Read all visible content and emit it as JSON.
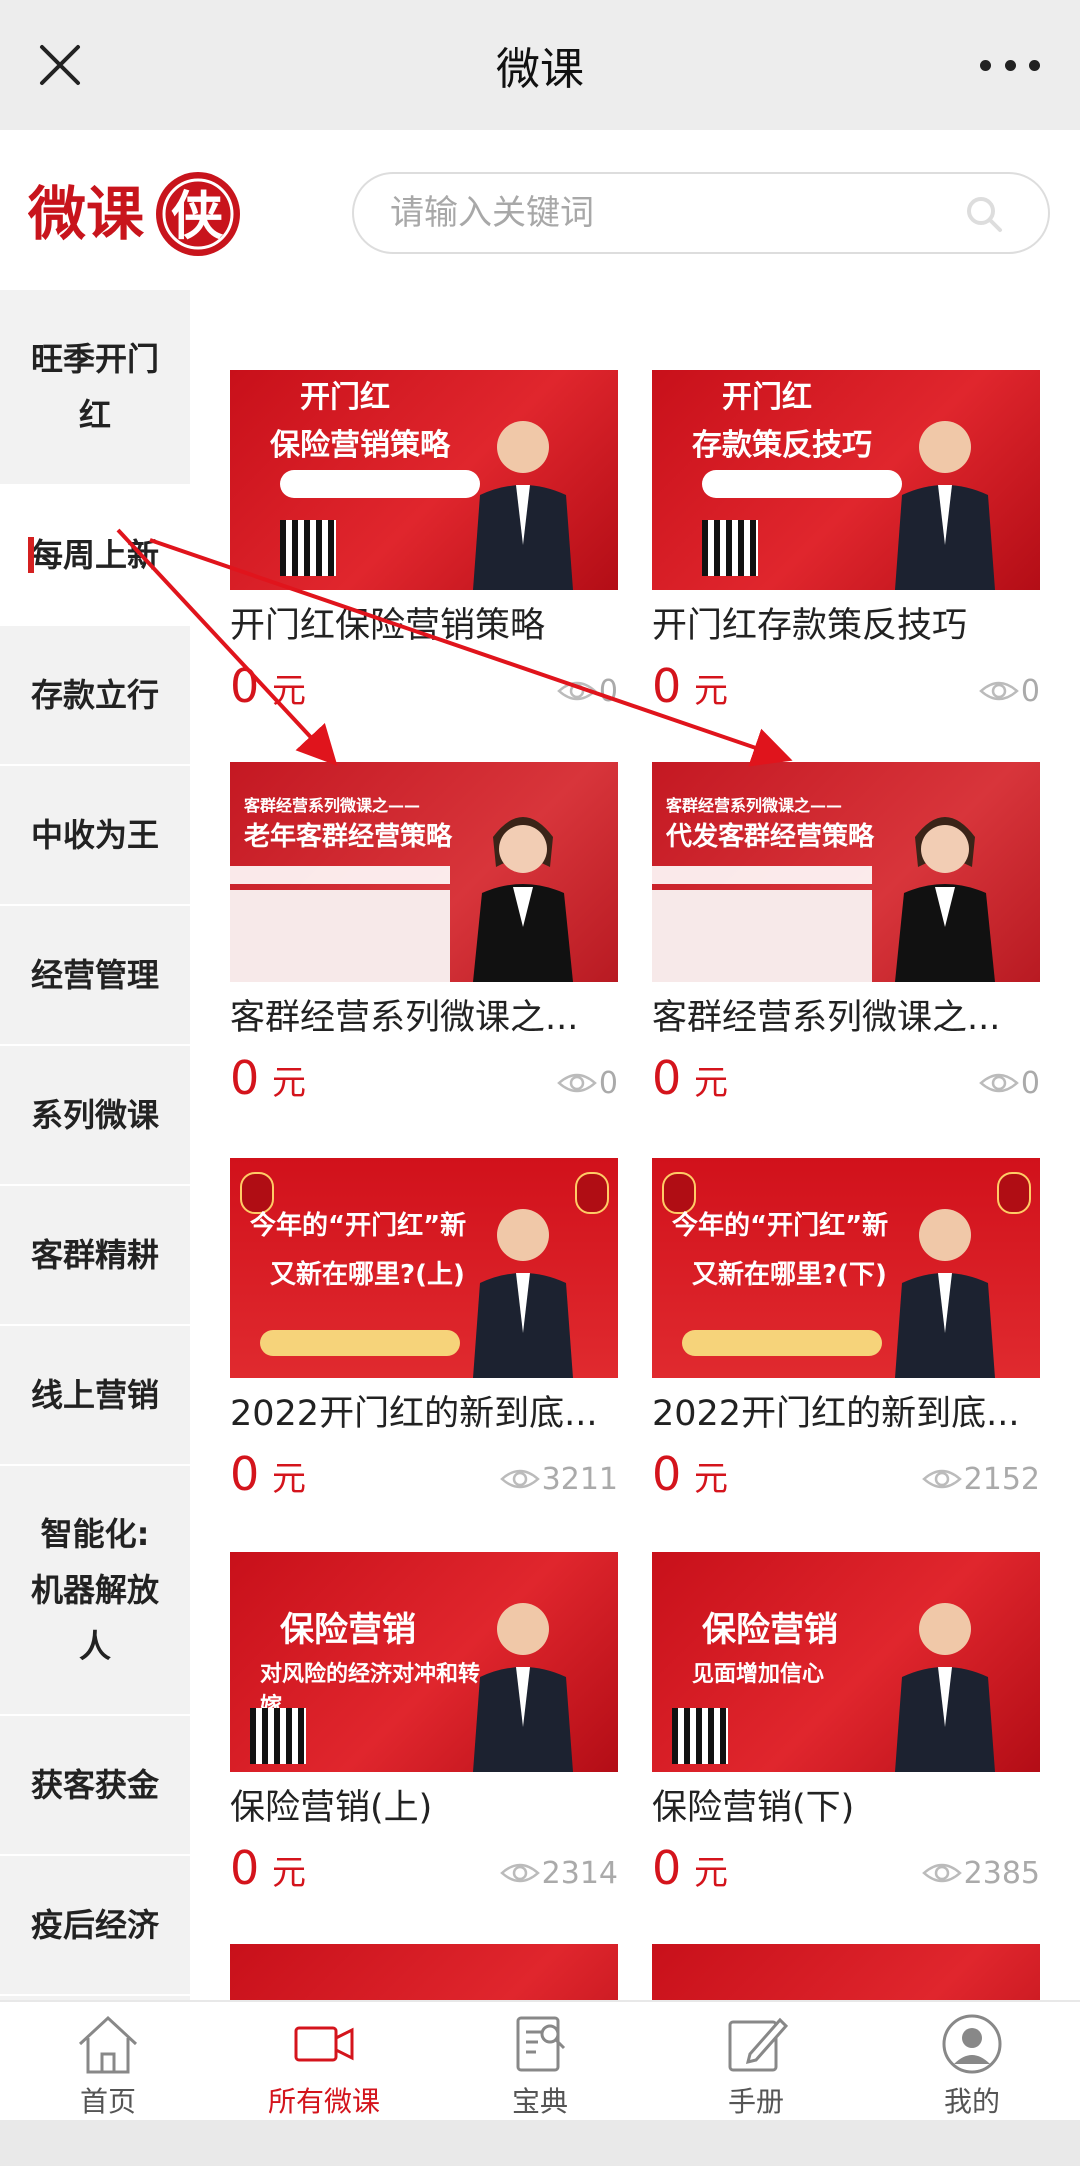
{
  "topbar": {
    "title": "微课"
  },
  "logo": {
    "text": "微课侠"
  },
  "search": {
    "placeholder": "请输入关键词"
  },
  "sidebar": {
    "items": [
      {
        "label": "旺季开门红"
      },
      {
        "label": "每周上新",
        "active": true
      },
      {
        "label": "存款立行"
      },
      {
        "label": "中收为王"
      },
      {
        "label": "经营管理"
      },
      {
        "label": "系列微课"
      },
      {
        "label": "客群精耕"
      },
      {
        "label": "线上营销"
      },
      {
        "label": "智能化:机器解放人"
      },
      {
        "label": "获客获金"
      },
      {
        "label": "疫后经济"
      }
    ]
  },
  "courses": [
    {
      "title": "开门红保险营销策略",
      "price": "0",
      "unit": "元",
      "views": "0",
      "thumb": {
        "line1": "开门红",
        "line2": "保险营销策略"
      }
    },
    {
      "title": "开门红存款策反技巧",
      "price": "0",
      "unit": "元",
      "views": "0",
      "thumb": {
        "line1": "开门红",
        "line2": "存款策反技巧"
      }
    },
    {
      "title": "客群经营系列微课之...",
      "price": "0",
      "unit": "元",
      "views": "0",
      "thumb": {
        "line1": "客群经营系列微课之——",
        "line2": "老年客群经营策略"
      }
    },
    {
      "title": "客群经营系列微课之...",
      "price": "0",
      "unit": "元",
      "views": "0",
      "thumb": {
        "line1": "客群经营系列微课之——",
        "line2": "代发客群经营策略"
      }
    },
    {
      "title": "2022开门红的新到底...",
      "price": "0",
      "unit": "元",
      "views": "3211",
      "thumb": {
        "line1": "今年的“开门红”新",
        "line2": "又新在哪里?(上)"
      }
    },
    {
      "title": "2022开门红的新到底...",
      "price": "0",
      "unit": "元",
      "views": "2152",
      "thumb": {
        "line1": "今年的“开门红”新",
        "line2": "又新在哪里?(下)"
      }
    },
    {
      "title": "保险营销(上)",
      "price": "0",
      "unit": "元",
      "views": "2314",
      "thumb": {
        "line1": "保险营销",
        "line2": "对风险的经济对冲和转嫁"
      }
    },
    {
      "title": "保险营销(下)",
      "price": "0",
      "unit": "元",
      "views": "2385",
      "thumb": {
        "line1": "保险营销",
        "line2": "见面增加信心"
      }
    }
  ],
  "tabs": [
    {
      "label": "首页",
      "icon": "home-icon"
    },
    {
      "label": "所有微课",
      "icon": "video-icon",
      "active": true
    },
    {
      "label": "宝典",
      "icon": "book-search-icon"
    },
    {
      "label": "手册",
      "icon": "edit-icon"
    },
    {
      "label": "我的",
      "icon": "user-icon"
    }
  ],
  "colors": {
    "accent": "#d4141c",
    "sidebar_bg": "#f2f2f2",
    "topbar_bg": "#ededed"
  }
}
